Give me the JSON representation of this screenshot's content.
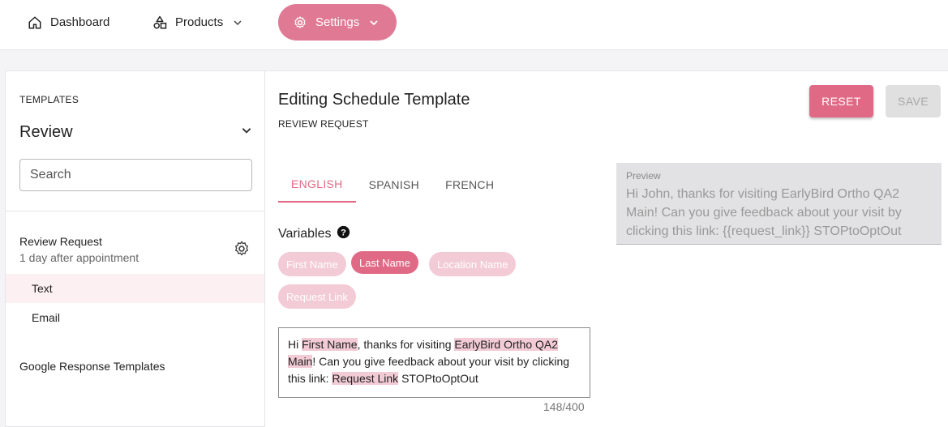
{
  "nav": {
    "dashboard_label": "Dashboard",
    "products_label": "Products",
    "settings_label": "Settings"
  },
  "colors": {
    "accent": "#e06a86",
    "settings_pill": "#e07a94",
    "chip_light": "#f2cbd6",
    "active_item_bg": "#fcf0f3"
  },
  "sidebar": {
    "heading": "TEMPLATES",
    "selected_category": "Review",
    "search_placeholder": "Search",
    "template": {
      "title": "Review Request",
      "subtitle": "1 day after appointment",
      "items": [
        {
          "label": "Text",
          "active": true
        },
        {
          "label": "Email",
          "active": false
        }
      ]
    },
    "google_templates_label": "Google Response Templates"
  },
  "main": {
    "title": "Editing Schedule Template",
    "subtitle": "REVIEW REQUEST",
    "reset_label": "RESET",
    "save_label": "SAVE",
    "tabs": [
      {
        "label": "ENGLISH",
        "active": true
      },
      {
        "label": "SPANISH",
        "active": false
      },
      {
        "label": "FRENCH",
        "active": false
      }
    ],
    "variables_label": "Variables",
    "variables": [
      {
        "label": "First Name",
        "selected": false
      },
      {
        "label": "Last Name",
        "selected": true
      },
      {
        "label": "Location Name",
        "selected": false
      },
      {
        "label": "Request Link",
        "selected": false
      }
    ],
    "editor": {
      "t1": "Hi ",
      "v1": "First Name",
      "t2": ", thanks for visiting ",
      "v2": "EarlyBird Ortho QA2 Main",
      "t3": "! Can you give feedback about your visit by clicking this link: ",
      "v3": "Request Link",
      "t4": " STOPtoOptOut"
    },
    "char_count": "148/400",
    "preview": {
      "label": "Preview",
      "text": "Hi John, thanks for visiting EarlyBird Ortho QA2 Main! Can you give feedback about your visit by clicking this link: {{request_link}} STOPtoOptOut"
    }
  }
}
